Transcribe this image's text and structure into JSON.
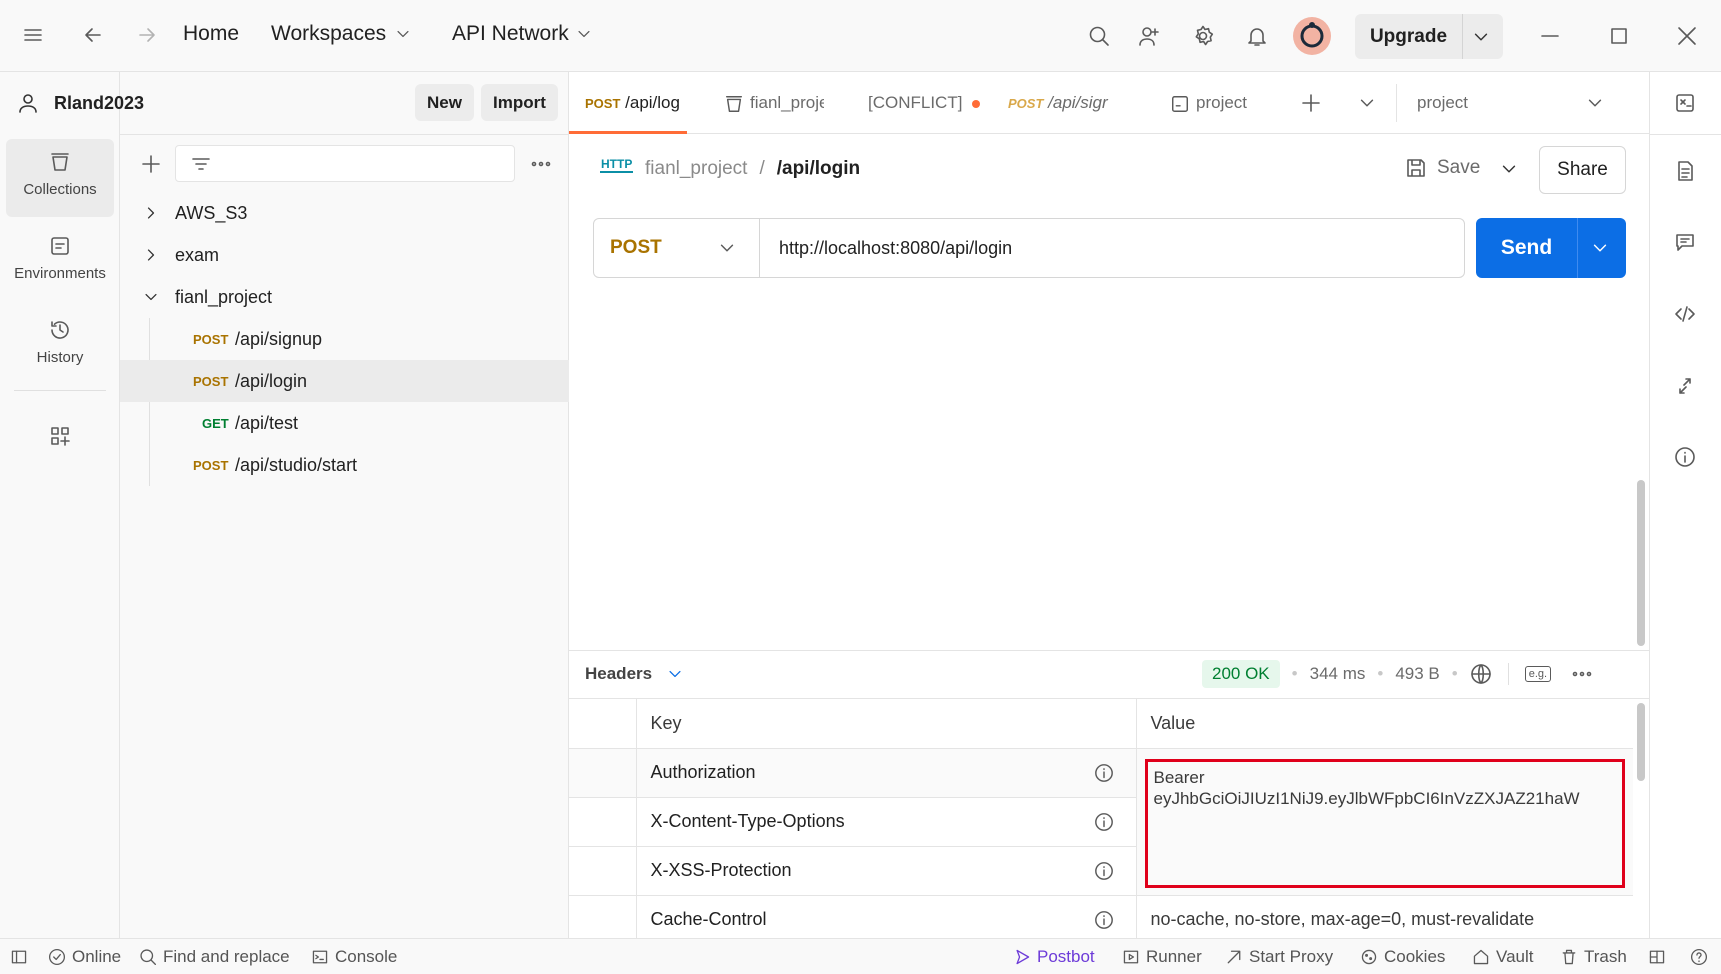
{
  "titlebar": {
    "home": "Home",
    "workspaces": "Workspaces",
    "api_network": "API Network",
    "upgrade": "Upgrade"
  },
  "rail": {
    "items": [
      {
        "label": "Collections",
        "icon": "collections-icon"
      },
      {
        "label": "Environments",
        "icon": "environments-icon"
      },
      {
        "label": "History",
        "icon": "history-icon"
      }
    ]
  },
  "sidebar": {
    "workspace_name": "Rland2023",
    "new_label": "New",
    "import_label": "Import",
    "tree": [
      {
        "label": "AWS_S3"
      },
      {
        "label": "exam"
      },
      {
        "label": "fianl_project"
      }
    ],
    "requests": [
      {
        "method": "POST",
        "path": "/api/signup"
      },
      {
        "method": "POST",
        "path": "/api/login"
      },
      {
        "method": "GET",
        "path": "/api/test"
      },
      {
        "method": "POST",
        "path": "/api/studio/start"
      }
    ]
  },
  "tabs": [
    {
      "method": "POST",
      "label": "/api/log"
    },
    {
      "label": "fianl_proje"
    },
    {
      "label": "[CONFLICT]"
    },
    {
      "method": "POST",
      "label": "/api/sigr"
    },
    {
      "label": "project"
    }
  ],
  "environment": {
    "selected": "project"
  },
  "request": {
    "breadcrumb_collection": "fianl_project",
    "breadcrumb_sep": "/",
    "breadcrumb_request": "/api/login",
    "http_badge": "HTTP",
    "save_label": "Save",
    "share_label": "Share",
    "method": "POST",
    "url": "http://localhost:8080/api/login",
    "send_label": "Send"
  },
  "response": {
    "tab_label": "Headers",
    "status": "200 OK",
    "time": "344 ms",
    "size": "493 B",
    "eg_label": "e.g.",
    "columns": {
      "key": "Key",
      "value": "Value"
    },
    "headers": [
      {
        "key": "Authorization",
        "value_line1": "Bearer",
        "value_line2": "eyJhbGciOiJIUzI1NiJ9.eyJlbWFpbCI6InVzZXJAZ21haW"
      },
      {
        "key": "X-Content-Type-Options",
        "value": ""
      },
      {
        "key": "X-XSS-Protection",
        "value": ""
      },
      {
        "key": "Cache-Control",
        "value": "no-cache, no-store, max-age=0, must-revalidate"
      }
    ],
    "highlight_color": "#e0001b"
  },
  "statusbar": {
    "online": "Online",
    "find_replace": "Find and replace",
    "console": "Console",
    "postbot": "Postbot",
    "runner": "Runner",
    "start_proxy": "Start Proxy",
    "cookies": "Cookies",
    "vault": "Vault",
    "trash": "Trash"
  },
  "colors": {
    "accent": "#0c6ee5",
    "post": "#a97300",
    "get": "#007f31",
    "unsaved_dot": "#ff6c37",
    "postbot": "#6d3bd8"
  }
}
